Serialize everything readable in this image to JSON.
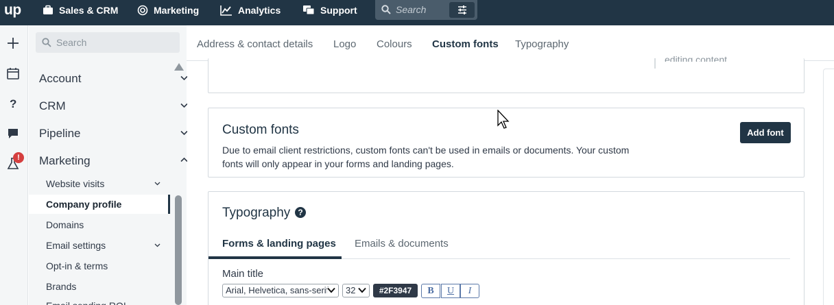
{
  "app": {
    "logo": "up",
    "nav": [
      "Sales & CRM",
      "Marketing",
      "Analytics",
      "Support"
    ],
    "search_placeholder": "Search"
  },
  "sidebar": {
    "search_placeholder": "Search",
    "sections": [
      "Account",
      "CRM",
      "Pipeline",
      "Marketing"
    ],
    "items": [
      "Website visits",
      "Company profile",
      "Domains",
      "Email settings",
      "Opt-in & terms",
      "Brands",
      "Email sending ROI"
    ],
    "active_item": "Company profile",
    "notification_count": "!"
  },
  "tabs": [
    "Address & contact details",
    "Logo",
    "Colours",
    "Custom fonts",
    "Typography"
  ],
  "active_tab": "Custom fonts",
  "top_card": {
    "hint_text": "editing content."
  },
  "custom_fonts": {
    "title": "Custom fonts",
    "description": "Due to email client restrictions, custom fonts can't be used in emails or documents. Your custom fonts will only appear in your forms and landing pages.",
    "add_button": "Add font"
  },
  "typography": {
    "title": "Typography",
    "help": "?",
    "sub_tabs": [
      "Forms & landing pages",
      "Emails & documents"
    ],
    "active_sub_tab": "Forms & landing pages",
    "field_label": "Main title",
    "font_family": "Arial, Helvetica, sans-serif",
    "font_size": "32",
    "color": "#2F3947",
    "bold": "B",
    "underline": "U",
    "italic": "I"
  },
  "colors": {
    "topbar": "#213545",
    "accent": "#213545",
    "badge": "#d53f3f"
  }
}
